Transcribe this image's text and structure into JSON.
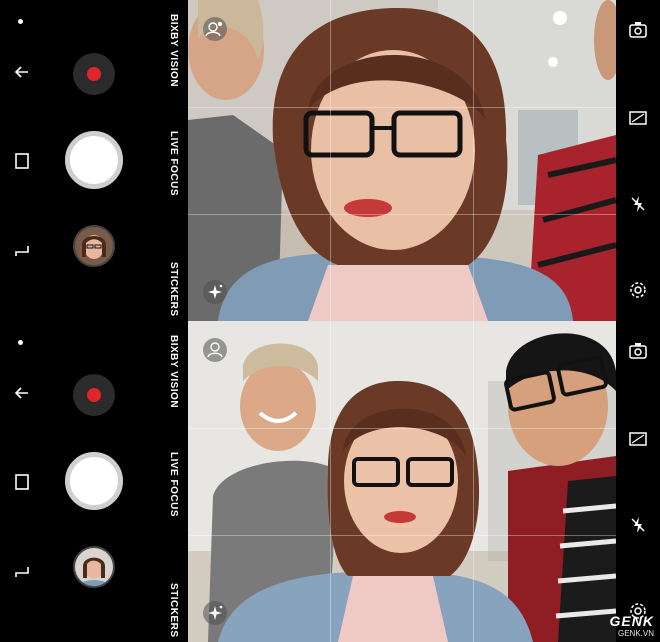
{
  "modes": {
    "bixby_vision": "BIXBY VISION",
    "live_focus": "LIVE FOCUS",
    "stickers": "STICKERS"
  },
  "icons": {
    "nav": [
      "dot-indicator",
      "back-arrow-icon",
      "recent-apps-icon",
      "menu-icon"
    ],
    "settings": [
      "switch-camera-icon",
      "aspect-ratio-icon",
      "flash-off-icon",
      "gear-icon"
    ],
    "viewfinder": [
      "face-effect-icon",
      "sparkle-icon"
    ]
  },
  "colors": {
    "record": "#e0262a",
    "shutter": "#ffffff"
  },
  "watermark": {
    "brand": "GENK",
    "site": "GENK.VN"
  }
}
